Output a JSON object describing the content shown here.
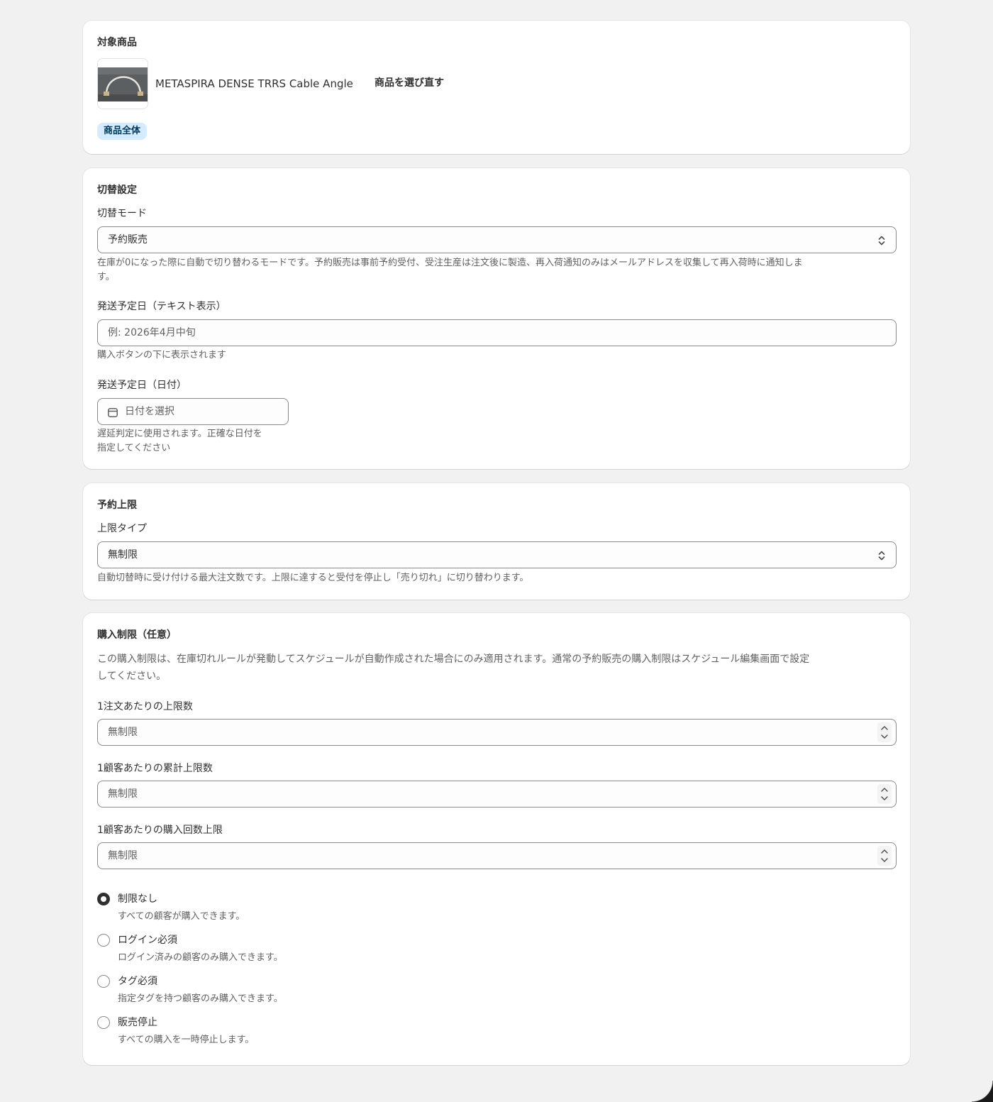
{
  "target_product": {
    "title": "対象商品",
    "product_name": "METASPIRA DENSE TRRS Cable Angle",
    "reselect_label": "商品を選び直す",
    "scope_badge": "商品全体"
  },
  "switch_settings": {
    "title": "切替設定",
    "mode_label": "切替モード",
    "mode_value": "予約販売",
    "mode_help_line1": "在庫が0になった際に自動で切り替わるモードです。予約販売は事前予約受付、受注生産は注文後に製造、再入荷通知のみはメールアドレスを収集して再入荷時に通知しま",
    "mode_help_line2": "す。",
    "ship_text_label": "発送予定日（テキスト表示）",
    "ship_text_placeholder": "例: 2026年4月中旬",
    "ship_text_help": "購入ボタンの下に表示されます",
    "ship_date_label": "発送予定日（日付）",
    "ship_date_placeholder": "日付を選択",
    "ship_date_help_line1": "遅延判定に使用されます。正確な日付を",
    "ship_date_help_line2": "指定してください"
  },
  "reservation_limit": {
    "title": "予約上限",
    "type_label": "上限タイプ",
    "type_value": "無制限",
    "help": "自動切替時に受け付ける最大注文数です。上限に達すると受付を停止し「売り切れ」に切り替わります。"
  },
  "purchase_limit": {
    "title": "購入制限（任意）",
    "description_line1": "この購入制限は、在庫切れルールが発動してスケジュールが自動作成された場合にのみ適用されます。通常の予約販売の購入制限はスケジュール編集画面で設定",
    "description_line2": "してください。",
    "per_order_label": "1注文あたりの上限数",
    "per_order_placeholder": "無制限",
    "per_customer_total_label": "1顧客あたりの累計上限数",
    "per_customer_total_placeholder": "無制限",
    "per_customer_count_label": "1顧客あたりの購入回数上限",
    "per_customer_count_placeholder": "無制限",
    "options": [
      {
        "label": "制限なし",
        "help": "すべての顧客が購入できます。",
        "checked": true
      },
      {
        "label": "ログイン必須",
        "help": "ログイン済みの顧客のみ購入できます。",
        "checked": false
      },
      {
        "label": "タグ必須",
        "help": "指定タグを持つ顧客のみ購入できます。",
        "checked": false
      },
      {
        "label": "販売停止",
        "help": "すべての購入を一時停止します。",
        "checked": false
      }
    ]
  },
  "icons": [
    "calendar-icon",
    "select-chevron-icon",
    "spinner-icon"
  ],
  "colors": {
    "page_background": "#f1f1f1",
    "card_background": "#ffffff",
    "badge_background": "#d5ebff",
    "text_primary": "#303030",
    "text_secondary": "#616161"
  }
}
